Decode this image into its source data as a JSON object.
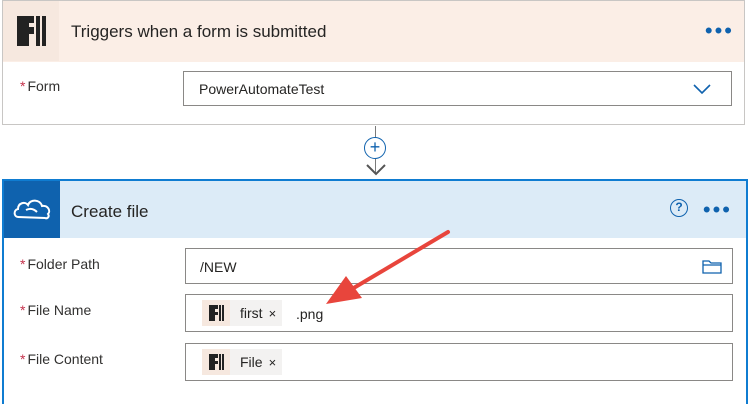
{
  "trigger_card": {
    "title": "Triggers when a form is submitted",
    "more_icon": "more-horizontal-icon",
    "form_field": {
      "required_mark": "*",
      "label": "Form",
      "value": "PowerAutomateTest",
      "dropdown_icon": "chevron-down-icon"
    }
  },
  "connector": {
    "add_symbol": "+"
  },
  "action_card": {
    "title": "Create file",
    "help_symbol": "?",
    "more_icon": "more-horizontal-icon",
    "folder_field": {
      "required_mark": "*",
      "label": "Folder Path",
      "value": "/NEW",
      "picker_icon": "folder-icon"
    },
    "filename_field": {
      "required_mark": "*",
      "label": "File Name",
      "token_label": "first",
      "token_remove": "×",
      "suffix": ".png"
    },
    "content_field": {
      "required_mark": "*",
      "label": "File Content",
      "token_label": "File",
      "token_remove": "×"
    }
  },
  "colors": {
    "accent": "#0f62ae",
    "annotation_arrow": "#e8453c",
    "trigger_header": "#fbeee6",
    "action_header": "#dcebf7"
  }
}
